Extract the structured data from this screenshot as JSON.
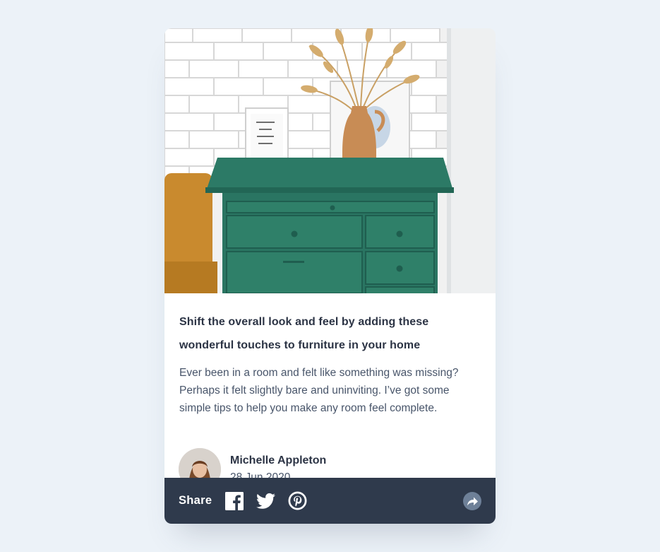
{
  "card": {
    "image_alt": "Green drawers with vase and framed print",
    "frame_text": "love will keep us alive",
    "title": "Shift the overall look and feel by adding these wonderful touches to furniture in your home",
    "description": "Ever been in a room and felt like something was missing? Perhaps it felt slightly bare and uninviting. I’ve got some simple tips to help you make any room feel complete.",
    "author": {
      "name": "Michelle Appleton",
      "date": "28 Jun 2020"
    }
  },
  "share": {
    "label": "Share",
    "icons": [
      "facebook-icon",
      "twitter-icon",
      "pinterest-icon",
      "share-icon"
    ]
  },
  "colors": {
    "background": "#ecf2f8",
    "share_bar": "#2f3a4c",
    "title": "#2c3445",
    "text": "#48556a",
    "share_button": "#6e8098"
  }
}
